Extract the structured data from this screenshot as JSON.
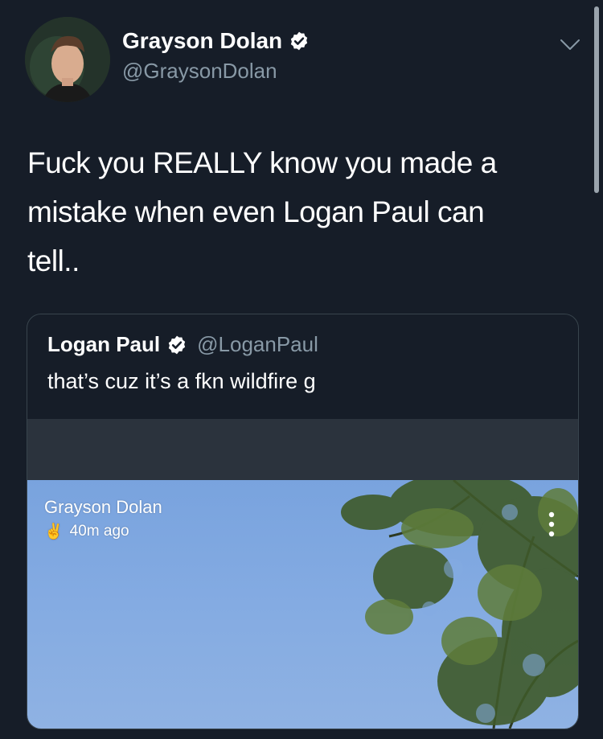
{
  "tweet": {
    "author": {
      "display_name": "Grayson Dolan",
      "handle": "@GraysonDolan",
      "verified": true
    },
    "text": "Fuck you REALLY know you made a\nmistake when even Logan Paul can\ntell.."
  },
  "quoted_tweet": {
    "author": {
      "display_name": "Logan Paul",
      "handle": "@LoganPaul",
      "verified": true
    },
    "text": "that’s cuz it’s a fkn wildfire g",
    "media": {
      "overlay_name": "Grayson Dolan",
      "overlay_time": "40m ago",
      "overlay_emoji": "✌️"
    }
  },
  "icons": {
    "verified": "verified-badge-icon",
    "menu": "chevron-down-icon",
    "more": "vertical-dots-icon"
  },
  "colors": {
    "background": "#161d28",
    "text_primary": "#ffffff",
    "text_secondary": "#8899a6",
    "card_border": "#38444d",
    "sky": "#84abe2"
  }
}
